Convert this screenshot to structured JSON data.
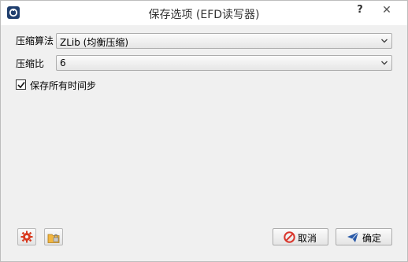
{
  "window": {
    "title": "保存选项 (EFD读写器)",
    "help_label": "?",
    "close_label": "✕"
  },
  "form": {
    "algorithm_label": "压缩算法",
    "algorithm_value": "ZLib (均衡压缩)",
    "ratio_label": "压缩比",
    "ratio_value": "6",
    "save_all_label": "保存所有时间步",
    "save_all_checked": true
  },
  "buttons": {
    "cancel_label": "取消",
    "ok_label": "确定"
  },
  "icons": {
    "app": "app-logo-icon",
    "settings": "gear-icon",
    "lock": "lock-folder-icon",
    "cancel": "no-entry-icon",
    "ok": "paper-plane-icon"
  },
  "colors": {
    "accent_blue": "#2a5aa8",
    "cancel_red": "#d9352b",
    "gear_red": "#d8391e"
  }
}
